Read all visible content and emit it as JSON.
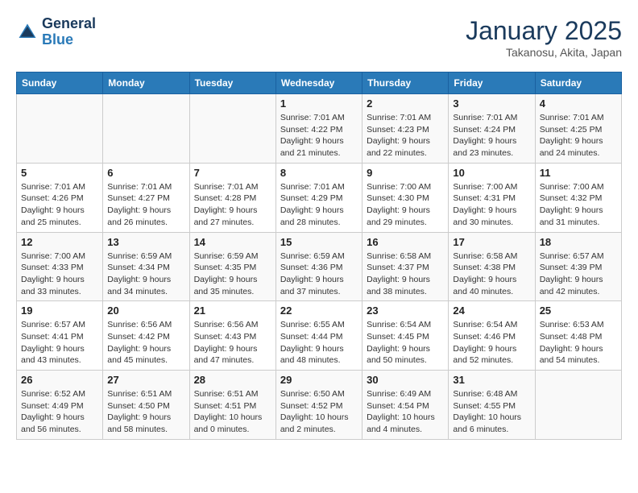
{
  "header": {
    "logo_line1": "General",
    "logo_line2": "Blue",
    "month": "January 2025",
    "location": "Takanosu, Akita, Japan"
  },
  "weekdays": [
    "Sunday",
    "Monday",
    "Tuesday",
    "Wednesday",
    "Thursday",
    "Friday",
    "Saturday"
  ],
  "weeks": [
    [
      {
        "day": "",
        "info": ""
      },
      {
        "day": "",
        "info": ""
      },
      {
        "day": "",
        "info": ""
      },
      {
        "day": "1",
        "info": "Sunrise: 7:01 AM\nSunset: 4:22 PM\nDaylight: 9 hours\nand 21 minutes."
      },
      {
        "day": "2",
        "info": "Sunrise: 7:01 AM\nSunset: 4:23 PM\nDaylight: 9 hours\nand 22 minutes."
      },
      {
        "day": "3",
        "info": "Sunrise: 7:01 AM\nSunset: 4:24 PM\nDaylight: 9 hours\nand 23 minutes."
      },
      {
        "day": "4",
        "info": "Sunrise: 7:01 AM\nSunset: 4:25 PM\nDaylight: 9 hours\nand 24 minutes."
      }
    ],
    [
      {
        "day": "5",
        "info": "Sunrise: 7:01 AM\nSunset: 4:26 PM\nDaylight: 9 hours\nand 25 minutes."
      },
      {
        "day": "6",
        "info": "Sunrise: 7:01 AM\nSunset: 4:27 PM\nDaylight: 9 hours\nand 26 minutes."
      },
      {
        "day": "7",
        "info": "Sunrise: 7:01 AM\nSunset: 4:28 PM\nDaylight: 9 hours\nand 27 minutes."
      },
      {
        "day": "8",
        "info": "Sunrise: 7:01 AM\nSunset: 4:29 PM\nDaylight: 9 hours\nand 28 minutes."
      },
      {
        "day": "9",
        "info": "Sunrise: 7:00 AM\nSunset: 4:30 PM\nDaylight: 9 hours\nand 29 minutes."
      },
      {
        "day": "10",
        "info": "Sunrise: 7:00 AM\nSunset: 4:31 PM\nDaylight: 9 hours\nand 30 minutes."
      },
      {
        "day": "11",
        "info": "Sunrise: 7:00 AM\nSunset: 4:32 PM\nDaylight: 9 hours\nand 31 minutes."
      }
    ],
    [
      {
        "day": "12",
        "info": "Sunrise: 7:00 AM\nSunset: 4:33 PM\nDaylight: 9 hours\nand 33 minutes."
      },
      {
        "day": "13",
        "info": "Sunrise: 6:59 AM\nSunset: 4:34 PM\nDaylight: 9 hours\nand 34 minutes."
      },
      {
        "day": "14",
        "info": "Sunrise: 6:59 AM\nSunset: 4:35 PM\nDaylight: 9 hours\nand 35 minutes."
      },
      {
        "day": "15",
        "info": "Sunrise: 6:59 AM\nSunset: 4:36 PM\nDaylight: 9 hours\nand 37 minutes."
      },
      {
        "day": "16",
        "info": "Sunrise: 6:58 AM\nSunset: 4:37 PM\nDaylight: 9 hours\nand 38 minutes."
      },
      {
        "day": "17",
        "info": "Sunrise: 6:58 AM\nSunset: 4:38 PM\nDaylight: 9 hours\nand 40 minutes."
      },
      {
        "day": "18",
        "info": "Sunrise: 6:57 AM\nSunset: 4:39 PM\nDaylight: 9 hours\nand 42 minutes."
      }
    ],
    [
      {
        "day": "19",
        "info": "Sunrise: 6:57 AM\nSunset: 4:41 PM\nDaylight: 9 hours\nand 43 minutes."
      },
      {
        "day": "20",
        "info": "Sunrise: 6:56 AM\nSunset: 4:42 PM\nDaylight: 9 hours\nand 45 minutes."
      },
      {
        "day": "21",
        "info": "Sunrise: 6:56 AM\nSunset: 4:43 PM\nDaylight: 9 hours\nand 47 minutes."
      },
      {
        "day": "22",
        "info": "Sunrise: 6:55 AM\nSunset: 4:44 PM\nDaylight: 9 hours\nand 48 minutes."
      },
      {
        "day": "23",
        "info": "Sunrise: 6:54 AM\nSunset: 4:45 PM\nDaylight: 9 hours\nand 50 minutes."
      },
      {
        "day": "24",
        "info": "Sunrise: 6:54 AM\nSunset: 4:46 PM\nDaylight: 9 hours\nand 52 minutes."
      },
      {
        "day": "25",
        "info": "Sunrise: 6:53 AM\nSunset: 4:48 PM\nDaylight: 9 hours\nand 54 minutes."
      }
    ],
    [
      {
        "day": "26",
        "info": "Sunrise: 6:52 AM\nSunset: 4:49 PM\nDaylight: 9 hours\nand 56 minutes."
      },
      {
        "day": "27",
        "info": "Sunrise: 6:51 AM\nSunset: 4:50 PM\nDaylight: 9 hours\nand 58 minutes."
      },
      {
        "day": "28",
        "info": "Sunrise: 6:51 AM\nSunset: 4:51 PM\nDaylight: 10 hours\nand 0 minutes."
      },
      {
        "day": "29",
        "info": "Sunrise: 6:50 AM\nSunset: 4:52 PM\nDaylight: 10 hours\nand 2 minutes."
      },
      {
        "day": "30",
        "info": "Sunrise: 6:49 AM\nSunset: 4:54 PM\nDaylight: 10 hours\nand 4 minutes."
      },
      {
        "day": "31",
        "info": "Sunrise: 6:48 AM\nSunset: 4:55 PM\nDaylight: 10 hours\nand 6 minutes."
      },
      {
        "day": "",
        "info": ""
      }
    ]
  ]
}
